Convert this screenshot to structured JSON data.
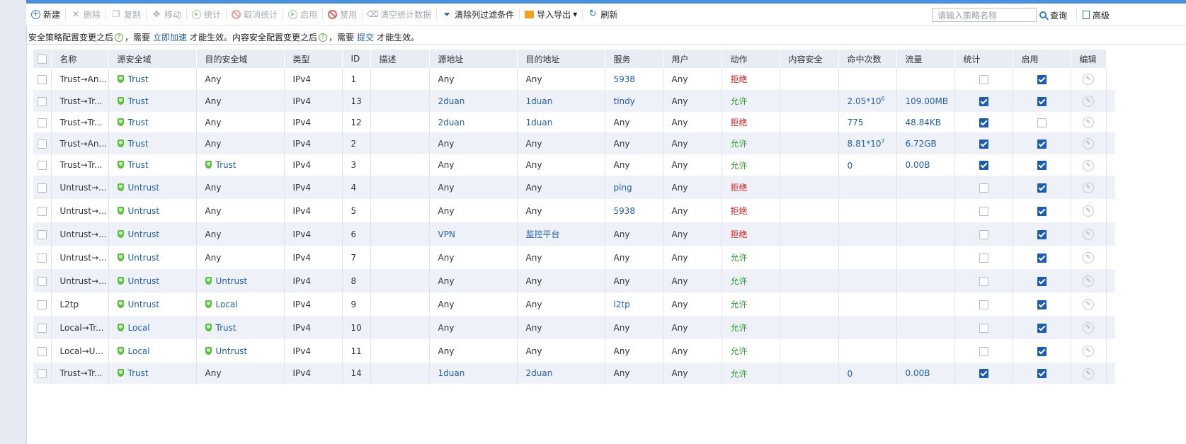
{
  "toolbar": {
    "new": "新建",
    "delete": "删除",
    "copy": "复制",
    "move": "移动",
    "stats": "统计",
    "cancel_stats": "取消统计",
    "enable": "启用",
    "disable": "禁用",
    "clear_stats": "清空统计数据",
    "clear_filters": "清除列过滤条件",
    "import_export": "导入导出",
    "refresh": "刷新"
  },
  "search": {
    "placeholder": "请输入策略名称",
    "button": "查询",
    "advanced": "高级"
  },
  "notice": {
    "part1": "安全策略配置变更之后",
    "part2": "，需要",
    "link1": "立即加速",
    "part3": "才能生效。内容安全配置变更之后",
    "part4": "，需要",
    "link2": "提交",
    "part5": "才能生效。"
  },
  "columns": [
    "名称",
    "源安全域",
    "目的安全域",
    "类型",
    "ID",
    "描述",
    "源地址",
    "目的地址",
    "服务",
    "用户",
    "动作",
    "内容安全",
    "命中次数",
    "流量",
    "统计",
    "启用",
    "编辑"
  ],
  "rows": [
    {
      "name": "Trust→An...",
      "src_zone": "Trust",
      "dst_zone": "Any",
      "type": "IPv4",
      "id": "1",
      "desc": "",
      "src_addr": "Any",
      "dst_addr": "Any",
      "service": "5938",
      "user": "Any",
      "action": "拒绝",
      "content": "",
      "hits": "",
      "hits_sup": "",
      "traffic": "",
      "stats": false,
      "enabled": true
    },
    {
      "name": "Trust→Tr...",
      "src_zone": "Trust",
      "dst_zone": "Any",
      "type": "IPv4",
      "id": "13",
      "desc": "",
      "src_addr": "2duan",
      "dst_addr": "1duan",
      "service": "tindy",
      "user": "Any",
      "action": "允许",
      "content": "",
      "hits": "2.05*10",
      "hits_sup": "6",
      "traffic": "109.00MB",
      "stats": true,
      "enabled": true
    },
    {
      "name": "Trust→Tr...",
      "src_zone": "Trust",
      "dst_zone": "Any",
      "type": "IPv4",
      "id": "12",
      "desc": "",
      "src_addr": "2duan",
      "dst_addr": "1duan",
      "service": "Any",
      "user": "Any",
      "action": "拒绝",
      "content": "",
      "hits": "775",
      "hits_sup": "",
      "traffic": "48.84KB",
      "stats": true,
      "enabled": false
    },
    {
      "name": "Trust→An...",
      "src_zone": "Trust",
      "dst_zone": "Any",
      "type": "IPv4",
      "id": "2",
      "desc": "",
      "src_addr": "Any",
      "dst_addr": "Any",
      "service": "Any",
      "user": "Any",
      "action": "允许",
      "content": "",
      "hits": "8.81*10",
      "hits_sup": "7",
      "traffic": "6.72GB",
      "stats": true,
      "enabled": true
    },
    {
      "name": "Trust→Tr...",
      "src_zone": "Trust",
      "dst_zone": "Trust",
      "type": "IPv4",
      "id": "3",
      "desc": "",
      "src_addr": "Any",
      "dst_addr": "Any",
      "service": "Any",
      "user": "Any",
      "action": "允许",
      "content": "",
      "hits": "0",
      "hits_sup": "",
      "traffic": "0.00B",
      "stats": true,
      "enabled": true
    },
    {
      "name": "Untrust→...",
      "src_zone": "Untrust",
      "dst_zone": "Any",
      "type": "IPv4",
      "id": "4",
      "desc": "",
      "src_addr": "Any",
      "dst_addr": "Any",
      "service": "ping",
      "user": "Any",
      "action": "拒绝",
      "content": "",
      "hits": "",
      "hits_sup": "",
      "traffic": "",
      "stats": false,
      "enabled": true
    },
    {
      "name": "Untrust→...",
      "src_zone": "Untrust",
      "dst_zone": "Any",
      "type": "IPv4",
      "id": "5",
      "desc": "",
      "src_addr": "Any",
      "dst_addr": "Any",
      "service": "5938",
      "user": "Any",
      "action": "拒绝",
      "content": "",
      "hits": "",
      "hits_sup": "",
      "traffic": "",
      "stats": false,
      "enabled": true
    },
    {
      "name": "Untrust→...",
      "src_zone": "Untrust",
      "dst_zone": "Any",
      "type": "IPv4",
      "id": "6",
      "desc": "",
      "src_addr": "VPN",
      "dst_addr": "监控平台",
      "service": "Any",
      "user": "Any",
      "action": "拒绝",
      "content": "",
      "hits": "",
      "hits_sup": "",
      "traffic": "",
      "stats": false,
      "enabled": true
    },
    {
      "name": "Untrust→...",
      "src_zone": "Untrust",
      "dst_zone": "Any",
      "type": "IPv4",
      "id": "7",
      "desc": "",
      "src_addr": "Any",
      "dst_addr": "Any",
      "service": "Any",
      "user": "Any",
      "action": "允许",
      "content": "",
      "hits": "",
      "hits_sup": "",
      "traffic": "",
      "stats": false,
      "enabled": true
    },
    {
      "name": "Untrust→...",
      "src_zone": "Untrust",
      "dst_zone": "Untrust",
      "type": "IPv4",
      "id": "8",
      "desc": "",
      "src_addr": "Any",
      "dst_addr": "Any",
      "service": "Any",
      "user": "Any",
      "action": "允许",
      "content": "",
      "hits": "",
      "hits_sup": "",
      "traffic": "",
      "stats": false,
      "enabled": true
    },
    {
      "name": "L2tp",
      "src_zone": "Untrust",
      "dst_zone": "Local",
      "type": "IPv4",
      "id": "9",
      "desc": "",
      "src_addr": "Any",
      "dst_addr": "Any",
      "service": "l2tp",
      "user": "Any",
      "action": "允许",
      "content": "",
      "hits": "",
      "hits_sup": "",
      "traffic": "",
      "stats": false,
      "enabled": true
    },
    {
      "name": "Local→Tr...",
      "src_zone": "Local",
      "dst_zone": "Trust",
      "type": "IPv4",
      "id": "10",
      "desc": "",
      "src_addr": "Any",
      "dst_addr": "Any",
      "service": "Any",
      "user": "Any",
      "action": "允许",
      "content": "",
      "hits": "",
      "hits_sup": "",
      "traffic": "",
      "stats": false,
      "enabled": true
    },
    {
      "name": "Local→U...",
      "src_zone": "Local",
      "dst_zone": "Untrust",
      "type": "IPv4",
      "id": "11",
      "desc": "",
      "src_addr": "Any",
      "dst_addr": "Any",
      "service": "Any",
      "user": "Any",
      "action": "允许",
      "content": "",
      "hits": "",
      "hits_sup": "",
      "traffic": "",
      "stats": false,
      "enabled": true
    },
    {
      "name": "Trust→Tr...",
      "src_zone": "Trust",
      "dst_zone": "Any",
      "type": "IPv4",
      "id": "14",
      "desc": "",
      "src_addr": "1duan",
      "dst_addr": "2duan",
      "service": "Any",
      "user": "Any",
      "action": "允许",
      "content": "",
      "hits": "0",
      "hits_sup": "",
      "traffic": "0.00B",
      "stats": true,
      "enabled": true
    }
  ],
  "colors": {
    "accent": "#1f5fb0",
    "deny": "#e02020",
    "allow": "#2d9a2d",
    "shield": "#5cbf3e",
    "header_bg": "#e8edf4",
    "stripe": "#eef2f8"
  }
}
